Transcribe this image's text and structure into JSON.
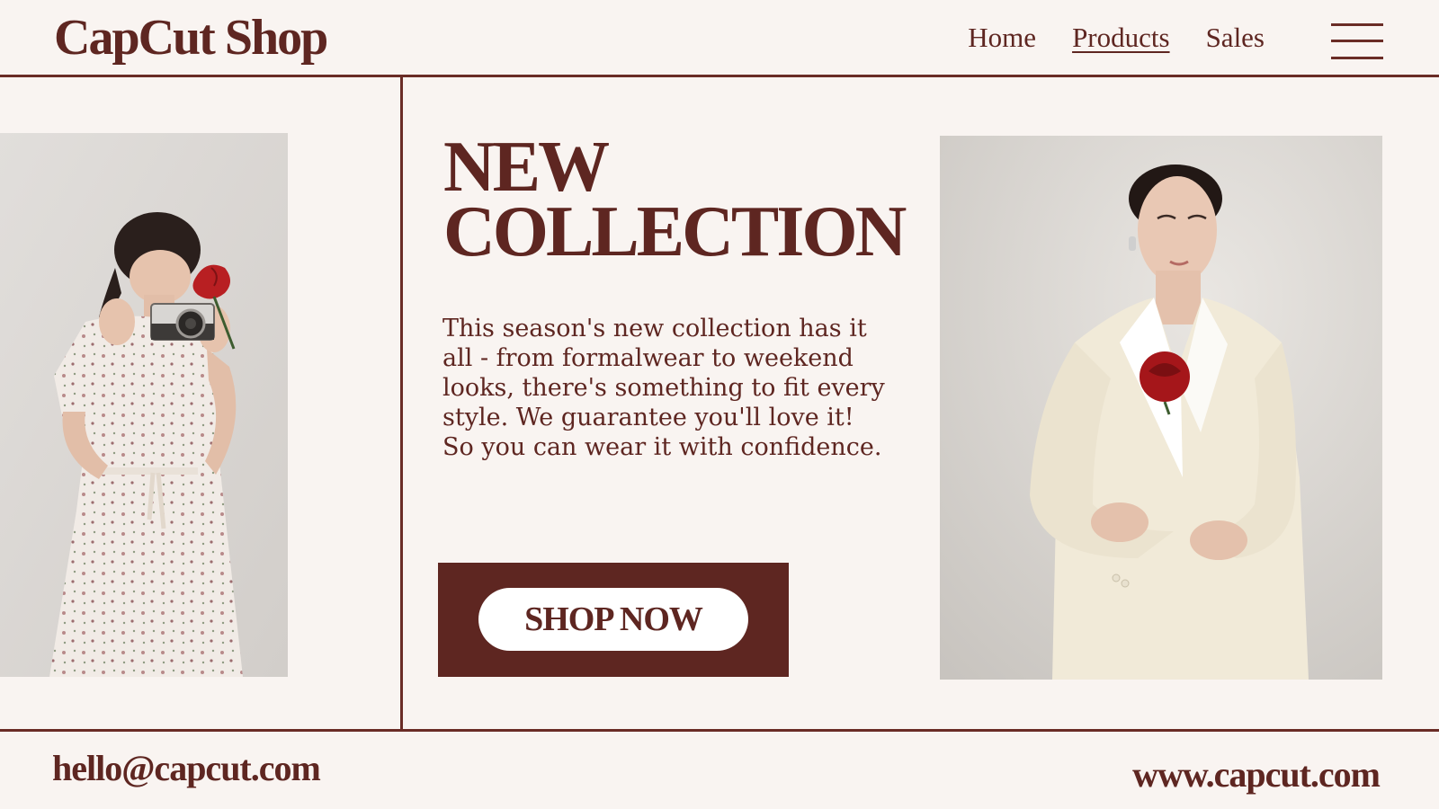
{
  "brand": "CapCut Shop",
  "nav": {
    "home": "Home",
    "products": "Products",
    "sales": "Sales"
  },
  "hero": {
    "headline_line1": "NEW",
    "headline_line2": "COLLECTION",
    "description": "This season's new collection has it all - from formalwear to weekend looks, there's something to fit every style. We guarantee you'll love it! So you can wear it with confidence.",
    "cta_label": "SHOP NOW"
  },
  "footer": {
    "email": "hello@capcut.com",
    "website": "www.capcut.com"
  },
  "colors": {
    "accent": "#5e2621",
    "background": "#f9f4f1",
    "button_bg": "#ffffff"
  },
  "icons": {
    "menu": "hamburger-menu-icon"
  }
}
